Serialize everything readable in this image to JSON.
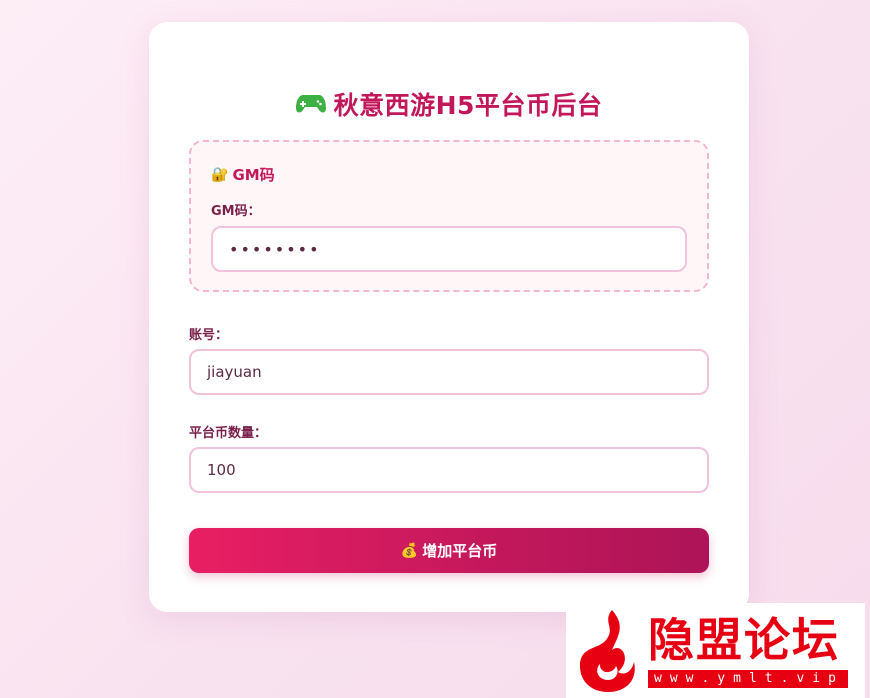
{
  "header": {
    "icon": "gamepad-icon",
    "title": "秋意西游H5平台币后台"
  },
  "gm_section": {
    "icon": "lock-key-icon",
    "heading": "GM码",
    "field_label": "GM码：",
    "field_value": "••••••••"
  },
  "account": {
    "label": "账号：",
    "value": "jiayuan"
  },
  "amount": {
    "label": "平台币数量：",
    "value": "100"
  },
  "submit": {
    "icon": "money-bag-icon",
    "label": "增加平台币"
  },
  "watermark": {
    "title": "隐盟论坛",
    "url": "www.ymlt.vip"
  },
  "colors": {
    "accent": "#c2185b",
    "button_start": "#e91e63",
    "button_end": "#ad1457",
    "input_border": "#f0c2dc",
    "dashed_border": "#f5b7cb",
    "watermark_red": "#e60012"
  }
}
